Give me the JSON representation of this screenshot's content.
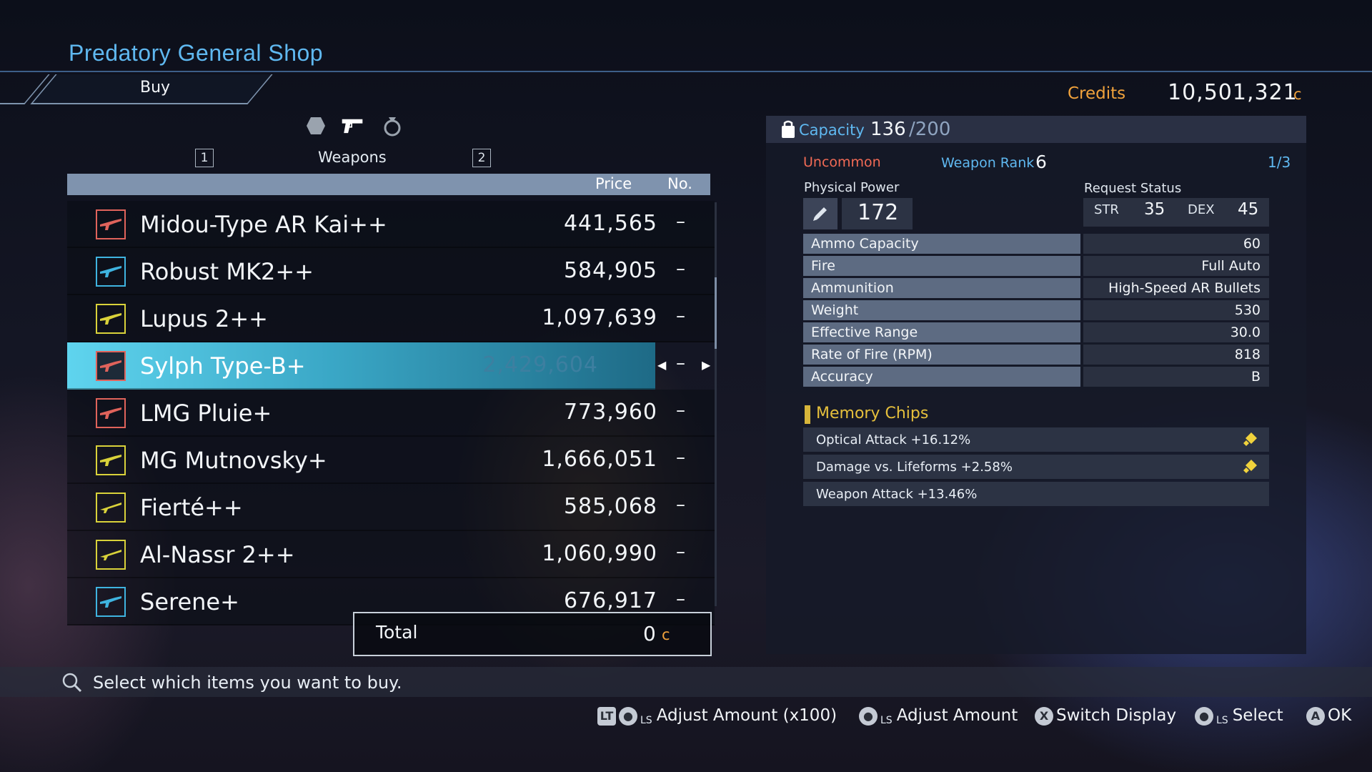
{
  "header": {
    "title": "Predatory General Shop",
    "tab": "Buy",
    "credits_label": "Credits",
    "credits_value": "10,501,321",
    "credits_unit": "c"
  },
  "category": {
    "key_left": "1",
    "key_right": "2",
    "label": "Weapons",
    "icons": [
      "hexagon-icon",
      "pistol-icon",
      "ring-icon"
    ]
  },
  "list": {
    "col_price": "Price",
    "col_no": "No.",
    "items": [
      {
        "name": "Midou-Type AR Kai++",
        "price": "441,565",
        "no": "–",
        "color": "#e0635b"
      },
      {
        "name": "Robust MK2++",
        "price": "584,905",
        "no": "–",
        "color": "#3fb4e0"
      },
      {
        "name": "Lupus 2++",
        "price": "1,097,639",
        "no": "–",
        "color": "#d9d23a"
      },
      {
        "name": "Sylph Type-B+",
        "price": "2,429,604",
        "no": "–",
        "color": "#e0635b"
      },
      {
        "name": "LMG Pluie+",
        "price": "773,960",
        "no": "–",
        "color": "#e0635b"
      },
      {
        "name": "MG Mutnovsky+",
        "price": "1,666,051",
        "no": "–",
        "color": "#d9d23a"
      },
      {
        "name": "Fierté++",
        "price": "585,068",
        "no": "–",
        "color": "#d9d23a"
      },
      {
        "name": "Al-Nassr 2++",
        "price": "1,060,990",
        "no": "–",
        "color": "#d9d23a"
      },
      {
        "name": "Serene+",
        "price": "676,917",
        "no": "–",
        "color": "#3fb4e0"
      }
    ],
    "total_label": "Total",
    "total_value": "0",
    "total_unit": "c"
  },
  "detail": {
    "capacity_label": "Capacity",
    "capacity_value": "136",
    "capacity_max": "/200",
    "rarity": "Uncommon",
    "rank_label": "Weapon Rank",
    "rank_value": "6",
    "page": "1/3",
    "physical_power_label": "Physical Power",
    "physical_power_value": "172",
    "request_status_label": "Request Status",
    "str_label": "STR",
    "str_value": "35",
    "dex_label": "DEX",
    "dex_value": "45",
    "stats": [
      {
        "label": "Ammo Capacity",
        "value": "60"
      },
      {
        "label": "Fire",
        "value": "Full Auto"
      },
      {
        "label": "Ammunition",
        "value": "High-Speed AR Bullets"
      },
      {
        "label": "Weight",
        "value": "530"
      },
      {
        "label": "Effective Range",
        "value": "30.0"
      },
      {
        "label": "Rate of Fire (RPM)",
        "value": "818"
      },
      {
        "label": "Accuracy",
        "value": "B"
      }
    ],
    "memory_chips_title": "Memory Chips",
    "chips": [
      {
        "label": "Optical Attack +16.12%",
        "icon": "diamond-icon"
      },
      {
        "label": "Damage vs. Lifeforms +2.58%",
        "icon": "diamond-icon"
      },
      {
        "label": "Weapon Attack +13.46%",
        "icon": ""
      }
    ]
  },
  "footer": {
    "hint": "Select which items you want to buy.",
    "controls": [
      {
        "btn": "LT",
        "stick": "LS",
        "label": "Adjust Amount (x100)"
      },
      {
        "stick": "LS",
        "label": "Adjust Amount"
      },
      {
        "btn": "X",
        "label": "Switch Display"
      },
      {
        "stick": "LS",
        "label": "Select"
      },
      {
        "btn": "A",
        "label": "OK"
      }
    ]
  }
}
